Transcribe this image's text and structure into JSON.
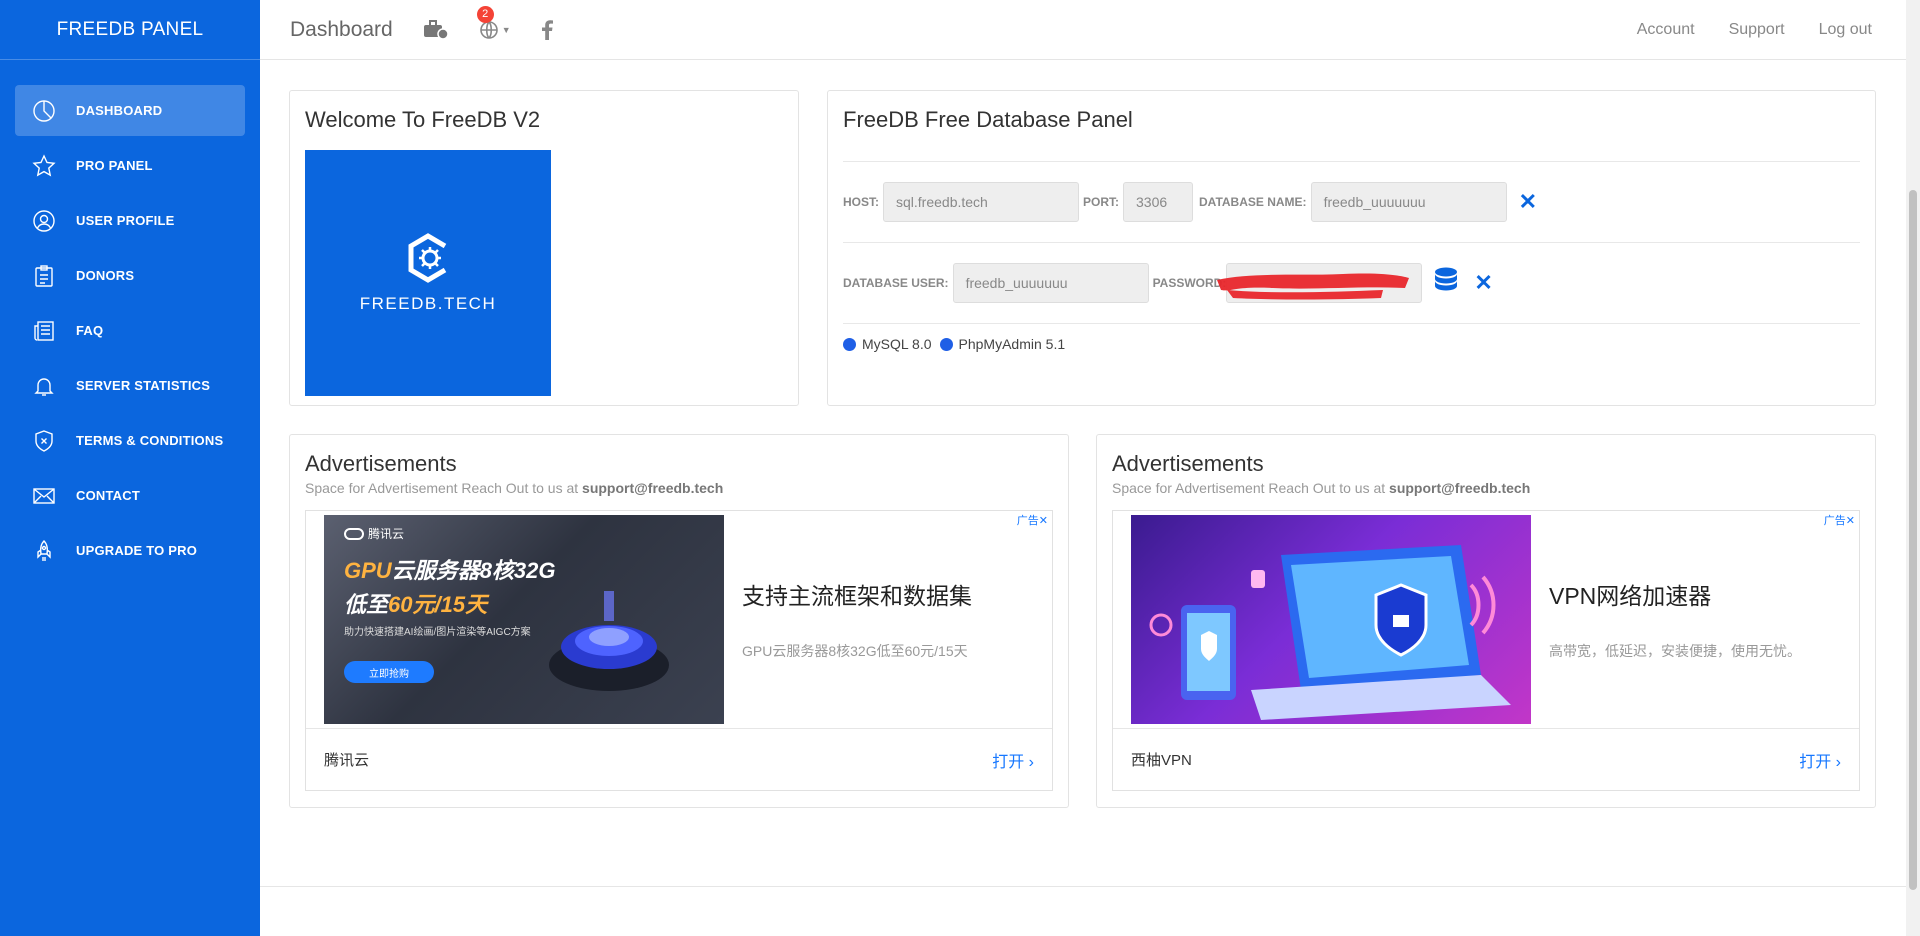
{
  "brand": "FREEDB PANEL",
  "sidebar": {
    "items": [
      {
        "label": "DASHBOARD",
        "icon": "pie-chart-icon",
        "active": true
      },
      {
        "label": "PRO PANEL",
        "icon": "star-icon"
      },
      {
        "label": "USER PROFILE",
        "icon": "user-icon"
      },
      {
        "label": "DONORS",
        "icon": "clipboard-icon"
      },
      {
        "label": "FAQ",
        "icon": "newspaper-icon"
      },
      {
        "label": "SERVER STATISTICS",
        "icon": "bell-icon"
      },
      {
        "label": "TERMS & CONDITIONS",
        "icon": "shield-icon"
      },
      {
        "label": "CONTACT",
        "icon": "mail-icon"
      },
      {
        "label": "UPGRADE TO PRO",
        "icon": "rocket-icon"
      }
    ]
  },
  "topbar": {
    "title": "Dashboard",
    "notification_count": "2",
    "links": {
      "account": "Account",
      "support": "Support",
      "logout": "Log out"
    }
  },
  "welcome": {
    "title": "Welcome To FreeDB V2",
    "logo_text": "FREEDB.TECH"
  },
  "panel": {
    "title": "FreeDB Free Database Panel",
    "host_label": "HOST:",
    "host_value": "sql.freedb.tech",
    "port_label": "PORT:",
    "port_value": "3306",
    "dbname_label": "DATABASE NAME:",
    "dbname_value": "freedb_uuuuuuu",
    "dbuser_label": "DATABASE USER:",
    "dbuser_value": "freedb_uuuuuuu",
    "password_label": "PASSWORD:",
    "clear_glyph": "✕",
    "chips": [
      "MySQL 8.0",
      "PhpMyAdmin 5.1"
    ]
  },
  "ads": [
    {
      "title": "Advertisements",
      "sub_prefix": "Space for Advertisement Reach Out to us at",
      "email": "support@freedb.tech",
      "mark": "广告✕",
      "image_brand": "腾讯云",
      "image_line1a": "GPU",
      "image_line1b": "云服务器8核32G",
      "image_line2a": "低至",
      "image_line2b": "60元/15天",
      "image_small": "助力快速搭建AI绘画/图片渲染等AIGC方案",
      "image_button": "立即抢购",
      "headline": "支持主流框架和数据集",
      "desc": "GPU云服务器8核32G低至60元/15天",
      "advertiser": "腾讯云",
      "open": "打开 ›"
    },
    {
      "title": "Advertisements",
      "sub_prefix": "Space for Advertisement Reach Out to us at",
      "email": "support@freedb.tech",
      "mark": "广告✕",
      "image_brand": "",
      "image_line1a": "",
      "image_line1b": "",
      "image_line2a": "",
      "image_line2b": "",
      "image_small": "",
      "image_button": "",
      "headline": "VPN网络加速器",
      "desc": "高带宽，低延迟，安装便捷，使用无忧。",
      "advertiser": "西柚VPN",
      "open": "打开 ›"
    }
  ],
  "colors": {
    "sidebar": "#0b66de",
    "accent": "#0b66de",
    "badge": "#f44336",
    "ad_link": "#1677ff"
  }
}
